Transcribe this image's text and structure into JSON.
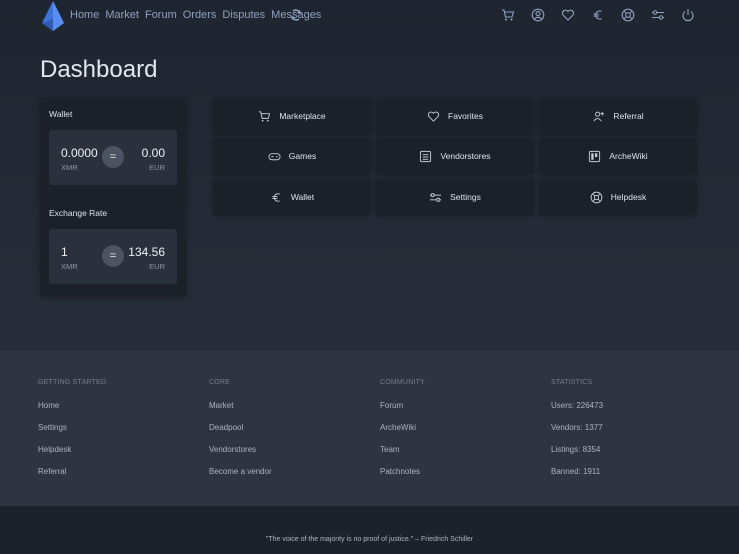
{
  "nav": {
    "links": [
      "Home",
      "Market",
      "Forum",
      "Orders",
      "Disputes",
      "Messages"
    ],
    "icons": [
      "cart-icon",
      "user-icon",
      "heart-icon",
      "euro-icon",
      "lifebuoy-icon",
      "settings-icon",
      "power-icon"
    ]
  },
  "page": {
    "title": "Dashboard"
  },
  "wallet": {
    "wallet_label": "Wallet",
    "balance_xmr": "0.0000",
    "balance_xmr_unit": "XMR",
    "balance_eur": "0.00",
    "balance_eur_unit": "EUR",
    "rate_label": "Exchange Rate",
    "rate_xmr": "1",
    "rate_xmr_unit": "XMR",
    "rate_eur": "134.56",
    "rate_eur_unit": "EUR",
    "equals": "="
  },
  "buttons": {
    "marketplace": "Marketplace",
    "favorites": "Favorites",
    "referral": "Referral",
    "games": "Games",
    "vendorstores": "Vendorstores",
    "archewiki": "ArcheWiki",
    "wallet": "Wallet",
    "settings": "Settings",
    "helpdesk": "Helpdesk"
  },
  "footer": {
    "getting_started": {
      "heading": "GETTING STARTED",
      "links": [
        "Home",
        "Settings",
        "Helpdesk",
        "Referral"
      ]
    },
    "core": {
      "heading": "CORE",
      "links": [
        "Market",
        "Deadpool",
        "Vendorstores",
        "Become a vendor"
      ]
    },
    "community": {
      "heading": "COMMUNITY",
      "links": [
        "Forum",
        "ArcheWiki",
        "Team",
        "Patchnotes"
      ]
    },
    "statistics": {
      "heading": "STATISTICS",
      "items": [
        "Users: 226473",
        "Vendors: 1377",
        "Listings: 8354",
        "Banned: 1911"
      ]
    }
  },
  "quote": "\"The voice of the majority is no proof of justice.\" – Friedrich Schiller",
  "colors": {
    "background": "#262c37",
    "card": "#1c2029",
    "footer": "#2f3540",
    "nav_link": "#8fa0bf",
    "logo": "#3f73d8"
  }
}
